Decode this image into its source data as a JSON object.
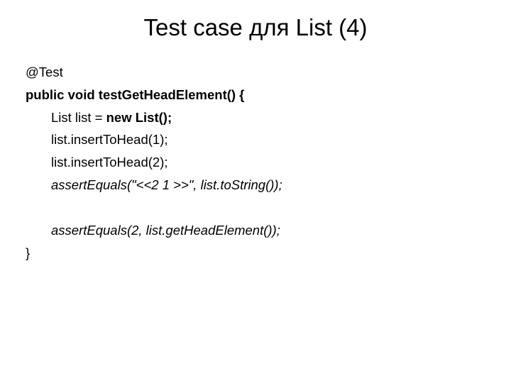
{
  "title": "Test case для List (4)",
  "code": {
    "l1": "@Test",
    "l2a": "public void",
    "l2b": " testGetHeadElement() {",
    "l3a": "List list = ",
    "l3b": "new List();",
    "l4": "list.insertToHead(1);",
    "l5": "list.insertToHead(2);",
    "l6": "assertEquals(\"<<2 1 >>\", list.toString());",
    "l7": "assertEquals(2, list.getHeadElement());",
    "l8": "}"
  }
}
